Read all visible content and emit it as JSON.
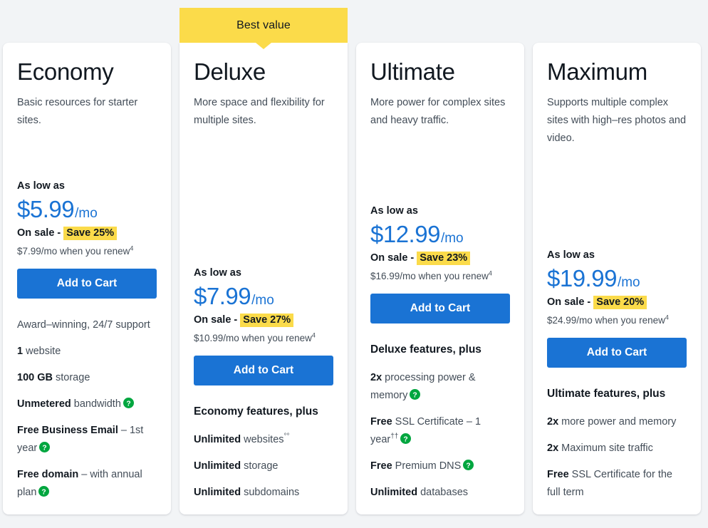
{
  "colors": {
    "page_background": "#f2f4f6",
    "card_background": "#ffffff",
    "accent_blue": "#1a73d4",
    "highlight_yellow": "#fbdb4a",
    "help_icon_green": "#00a63f",
    "heading_text": "#111820",
    "body_text": "#434d58"
  },
  "ribbon": {
    "label": "Best value"
  },
  "plans": [
    {
      "id": "economy",
      "title": "Economy",
      "description": "Basic resources for starter sites.",
      "as_low_as_label": "As low as",
      "price_amount": "$5.99",
      "price_period": "/mo",
      "sale_prefix": "On sale -",
      "sale_badge": "Save 25%",
      "renew_text": "$7.99/mo when you renew",
      "renew_footnote": "4",
      "cta_label": "Add to Cart",
      "features_heading": "",
      "features": [
        {
          "bold": "",
          "text": "Award–winning, 24/7 support",
          "sup": "",
          "help_icon": false
        },
        {
          "bold": "1",
          "text": " website",
          "sup": "",
          "help_icon": false
        },
        {
          "bold": "100 GB",
          "text": " storage",
          "sup": "",
          "help_icon": false
        },
        {
          "bold": "Unmetered",
          "text": " bandwidth",
          "sup": "",
          "help_icon": true
        },
        {
          "bold": "Free Business Email",
          "text": " – 1st year",
          "sup": "",
          "help_icon": true
        },
        {
          "bold": "Free domain",
          "text": " – with annual plan",
          "sup": "",
          "help_icon": true
        }
      ],
      "best_value": false
    },
    {
      "id": "deluxe",
      "title": "Deluxe",
      "description": "More space and flexibility for multiple sites.",
      "as_low_as_label": "As low as",
      "price_amount": "$7.99",
      "price_period": "/mo",
      "sale_prefix": "On sale -",
      "sale_badge": "Save 27%",
      "renew_text": "$10.99/mo when you renew",
      "renew_footnote": "4",
      "cta_label": "Add to Cart",
      "features_heading": "Economy features, plus",
      "features": [
        {
          "bold": "Unlimited",
          "text": " websites",
          "sup": "°°",
          "help_icon": false
        },
        {
          "bold": "Unlimited",
          "text": " storage",
          "sup": "",
          "help_icon": false
        },
        {
          "bold": "Unlimited",
          "text": " subdomains",
          "sup": "",
          "help_icon": false
        }
      ],
      "best_value": true
    },
    {
      "id": "ultimate",
      "title": "Ultimate",
      "description": "More power for complex sites and heavy traffic.",
      "as_low_as_label": "As low as",
      "price_amount": "$12.99",
      "price_period": "/mo",
      "sale_prefix": "On sale -",
      "sale_badge": "Save 23%",
      "renew_text": "$16.99/mo when you renew",
      "renew_footnote": "4",
      "cta_label": "Add to Cart",
      "features_heading": "Deluxe features, plus",
      "features": [
        {
          "bold": "2x",
          "text": " processing power & memory",
          "sup": "",
          "help_icon": true
        },
        {
          "bold": "Free",
          "text": " SSL Certificate – 1 year",
          "sup": "††",
          "help_icon": true
        },
        {
          "bold": "Free",
          "text": " Premium DNS",
          "sup": "",
          "help_icon": true
        },
        {
          "bold": "Unlimited",
          "text": " databases",
          "sup": "",
          "help_icon": false
        }
      ],
      "best_value": false
    },
    {
      "id": "maximum",
      "title": "Maximum",
      "description": "Supports multiple complex sites with high–res photos and video.",
      "as_low_as_label": "As low as",
      "price_amount": "$19.99",
      "price_period": "/mo",
      "sale_prefix": "On sale -",
      "sale_badge": "Save 20%",
      "renew_text": "$24.99/mo when you renew",
      "renew_footnote": "4",
      "cta_label": "Add to Cart",
      "features_heading": "Ultimate features, plus",
      "features": [
        {
          "bold": "2x",
          "text": " more power and memory",
          "sup": "",
          "help_icon": false
        },
        {
          "bold": "2x",
          "text": " Maximum site traffic",
          "sup": "",
          "help_icon": false
        },
        {
          "bold": "Free",
          "text": " SSL Certificate for the full term",
          "sup": "",
          "help_icon": false
        }
      ],
      "best_value": false
    }
  ]
}
